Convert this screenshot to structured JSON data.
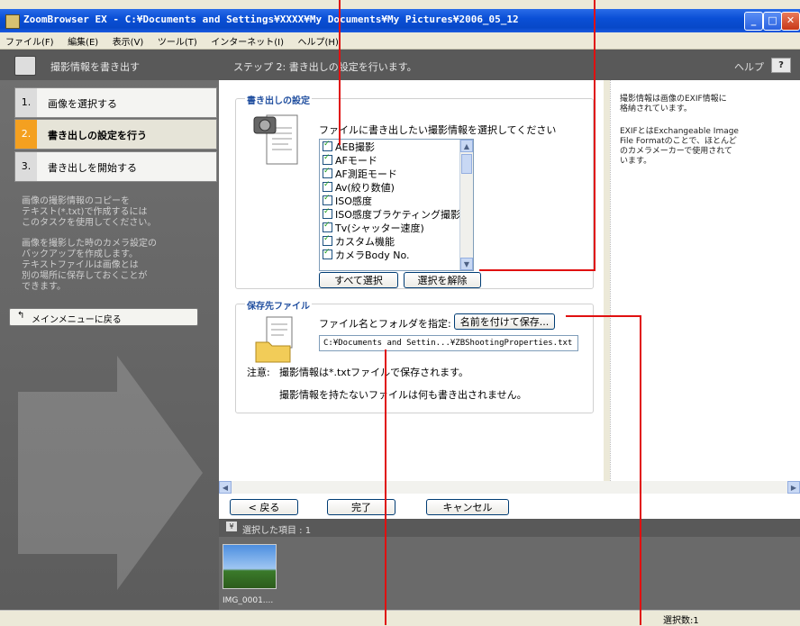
{
  "window": {
    "title": "ZoomBrowser EX - C:¥Documents and Settings¥XXXX¥My Documents¥My Pictures¥2006_05_12",
    "controls": [
      "_",
      "□",
      "✕"
    ]
  },
  "menu": [
    "ファイル(F)",
    "編集(E)",
    "表示(V)",
    "ツール(T)",
    "インターネット(I)",
    "ヘルプ(H)"
  ],
  "left": {
    "header": "撮影情報を書き出す",
    "steps": [
      {
        "num": "1.",
        "label": "画像を選択する"
      },
      {
        "num": "2.",
        "label": "書き出しの設定を行う"
      },
      {
        "num": "3.",
        "label": "書き出しを開始する"
      }
    ],
    "desc1": "画像の撮影情報のコピーを\nテキスト(*.txt)で作成するには\nこのタスクを使用してください。",
    "desc2": "画像を撮影した時のカメラ設定の\nバックアップを作成します。\nテキストファイルは画像とは\n別の場所に保存しておくことが\nできます。",
    "back": "メインメニューに戻る"
  },
  "center": {
    "header": "ステップ 2: 書き出しの設定を行います。",
    "help": "ヘルプ",
    "help_btn": "?"
  },
  "export_group": {
    "legend": "書き出しの設定",
    "instruction": "ファイルに書き出したい撮影情報を選択してください",
    "items": [
      "AEB撮影",
      "AFモード",
      "AF測距モード",
      "Av(絞り数値)",
      "ISO感度",
      "ISO感度ブラケティング撮影",
      "Tv(シャッター速度)",
      "カスタム機能",
      "カメラBody No."
    ],
    "select_all": "すべて選択",
    "deselect": "選択を解除"
  },
  "save_group": {
    "legend": "保存先ファイル",
    "label": "ファイル名とフォルダを指定:",
    "save_as": "名前を付けて保存...",
    "path": "C:¥Documents and Settin...¥ZBShootingProperties.txt",
    "note_label": "注意:",
    "note1": "撮影情報は*.txtファイルで保存されます。",
    "note2": "撮影情報を持たないファイルは何も書き出されません。"
  },
  "right": {
    "p1": "撮影情報は画像のEXIF情報に\n格納されています。",
    "p2": "EXIFとはExchangeable Image\nFile Formatのことで、ほとんど\nのカメラメーカーで使用されて\nいます。"
  },
  "nav": {
    "back": "< 戻る",
    "done": "完了",
    "cancel": "キャンセル"
  },
  "selection": {
    "label": "選択した項目 : 1"
  },
  "thumbs": [
    {
      "caption": "IMG_0001...."
    }
  ],
  "status": {
    "count": "選択数:1"
  }
}
